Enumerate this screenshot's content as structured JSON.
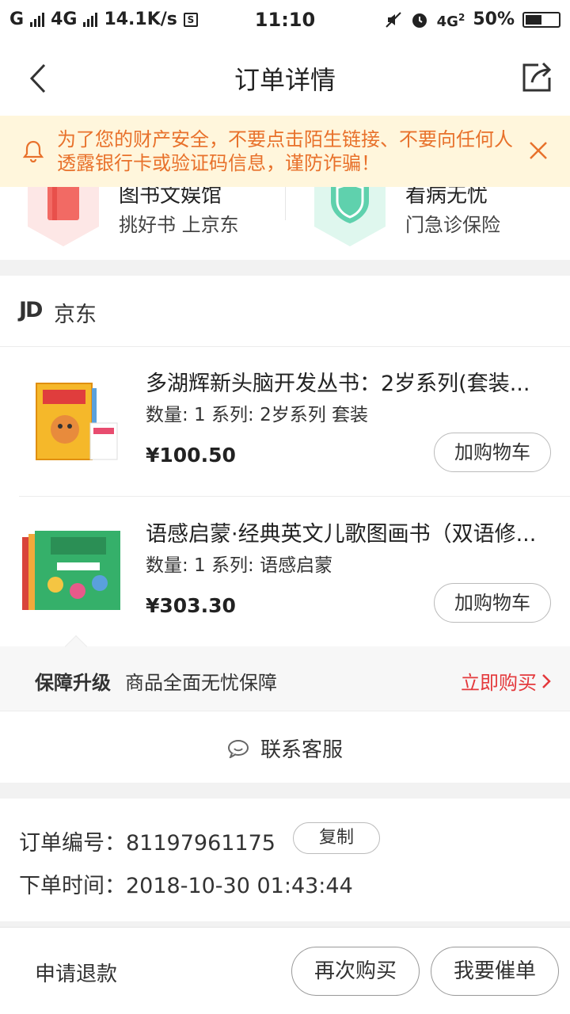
{
  "status_bar": {
    "carrier1": "G",
    "carrier2": "4G",
    "speed": "14.1K/s",
    "time": "11:10",
    "network": "4G",
    "network_sup": "2",
    "battery_text": "50%",
    "battery_level": 0.5
  },
  "navbar": {
    "title": "订单详情"
  },
  "notice": {
    "text": "为了您的财产安全，不要点击陌生链接、不要向任何人透露银行卡或验证码信息，谨防诈骗！"
  },
  "promo": {
    "left": {
      "title": "图书文娱馆",
      "subtitle": "挑好书 上京东"
    },
    "right": {
      "title": "看病无忧",
      "subtitle": "门急诊保险"
    }
  },
  "shop": {
    "logo": "JD",
    "name": "京东"
  },
  "products": [
    {
      "title": "多湖辉新头脑开发丛书：2岁系列(套装...",
      "spec": "数量: 1 系列: 2岁系列 套装",
      "price": "¥100.50",
      "cart_label": "加购物车"
    },
    {
      "title": "语感启蒙·经典英文儿歌图画书（双语修...",
      "spec": "数量: 1 系列: 语感启蒙",
      "price": "¥303.30",
      "cart_label": "加购物车"
    }
  ],
  "guarantee": {
    "label": "保障升级",
    "desc": "商品全面无忧保障",
    "action": "立即购买"
  },
  "service": {
    "label": "联系客服"
  },
  "order": {
    "number_label": "订单编号：81197961175",
    "copy_label": "复制",
    "time_label": "下单时间：2018-10-30 01:43:44"
  },
  "bottom": {
    "refund": "申请退款",
    "rebuy": "再次购买",
    "urge": "我要催单"
  },
  "colors": {
    "accent_red": "#e4393c",
    "notice_orange": "#e8712b",
    "notice_bg": "#fff6dc"
  }
}
